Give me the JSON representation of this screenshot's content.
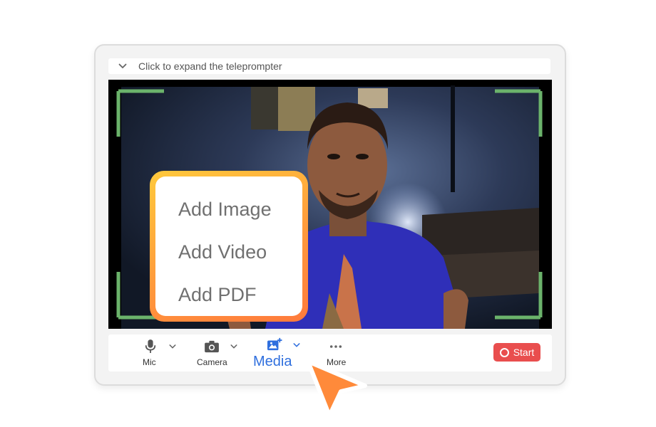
{
  "teleprompter": {
    "label": "Click to expand the teleprompter"
  },
  "controls": {
    "mic_label": "Mic",
    "camera_label": "Camera",
    "media_label": "Media",
    "more_label": "More",
    "start_label": "Start"
  },
  "media_menu": {
    "items": [
      "Add Image",
      "Add Video",
      "Add PDF"
    ]
  },
  "icons": {
    "teleprompter_toggle": "chevron-down-icon",
    "mic": "microphone-icon",
    "camera": "camera-icon",
    "media": "image-plus-icon",
    "more": "more-dots-icon",
    "start": "record-icon",
    "cursor": "pointer-arrow-icon"
  },
  "colors": {
    "accent_blue": "#2f6fde",
    "record_red": "#e94e4e",
    "frame_corner_green": "#6bb36b",
    "menu_gradient_start": "#ffc93c",
    "menu_gradient_end": "#ff7a3c",
    "cursor_orange": "#ff8a3a"
  }
}
